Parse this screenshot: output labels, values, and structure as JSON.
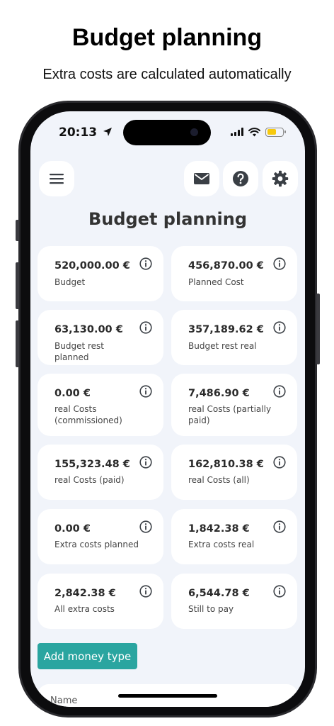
{
  "promo": {
    "title": "Budget planning",
    "subtitle": "Extra costs are calculated automatically"
  },
  "status_bar": {
    "time": "20:13",
    "icons": [
      "location-arrow-icon",
      "cellular-signal-icon",
      "wifi-icon",
      "battery-icon"
    ],
    "battery_color": "#f6c90e"
  },
  "header": {
    "buttons": [
      "menu-icon",
      "mail-icon",
      "help-icon",
      "settings-icon"
    ]
  },
  "page": {
    "title": "Budget planning"
  },
  "cards": [
    {
      "value": "520,000.00 €",
      "label": "Budget"
    },
    {
      "value": "456,870.00 €",
      "label": "Planned Cost"
    },
    {
      "value": "63,130.00 €",
      "label": "Budget rest planned"
    },
    {
      "value": "357,189.62 €",
      "label": "Budget rest real"
    },
    {
      "value": "0.00 €",
      "label": "real Costs (commissioned)"
    },
    {
      "value": "7,486.90 €",
      "label": "real Costs (partially paid)"
    },
    {
      "value": "155,323.48 €",
      "label": "real Costs (paid)"
    },
    {
      "value": "162,810.38 €",
      "label": "real Costs (all)"
    },
    {
      "value": "0.00 €",
      "label": "Extra costs planned"
    },
    {
      "value": "1,842.38 €",
      "label": "Extra costs real"
    },
    {
      "value": "2,842.38 €",
      "label": "All extra costs"
    },
    {
      "value": "6,544.78 €",
      "label": "Still to pay"
    }
  ],
  "actions": {
    "add_money_type": "Add money type"
  },
  "table": {
    "header_name": "Name"
  },
  "colors": {
    "accent": "#2aa5a0",
    "background": "#f1f4fa",
    "card": "#ffffff",
    "icon": "#3a3f45"
  }
}
